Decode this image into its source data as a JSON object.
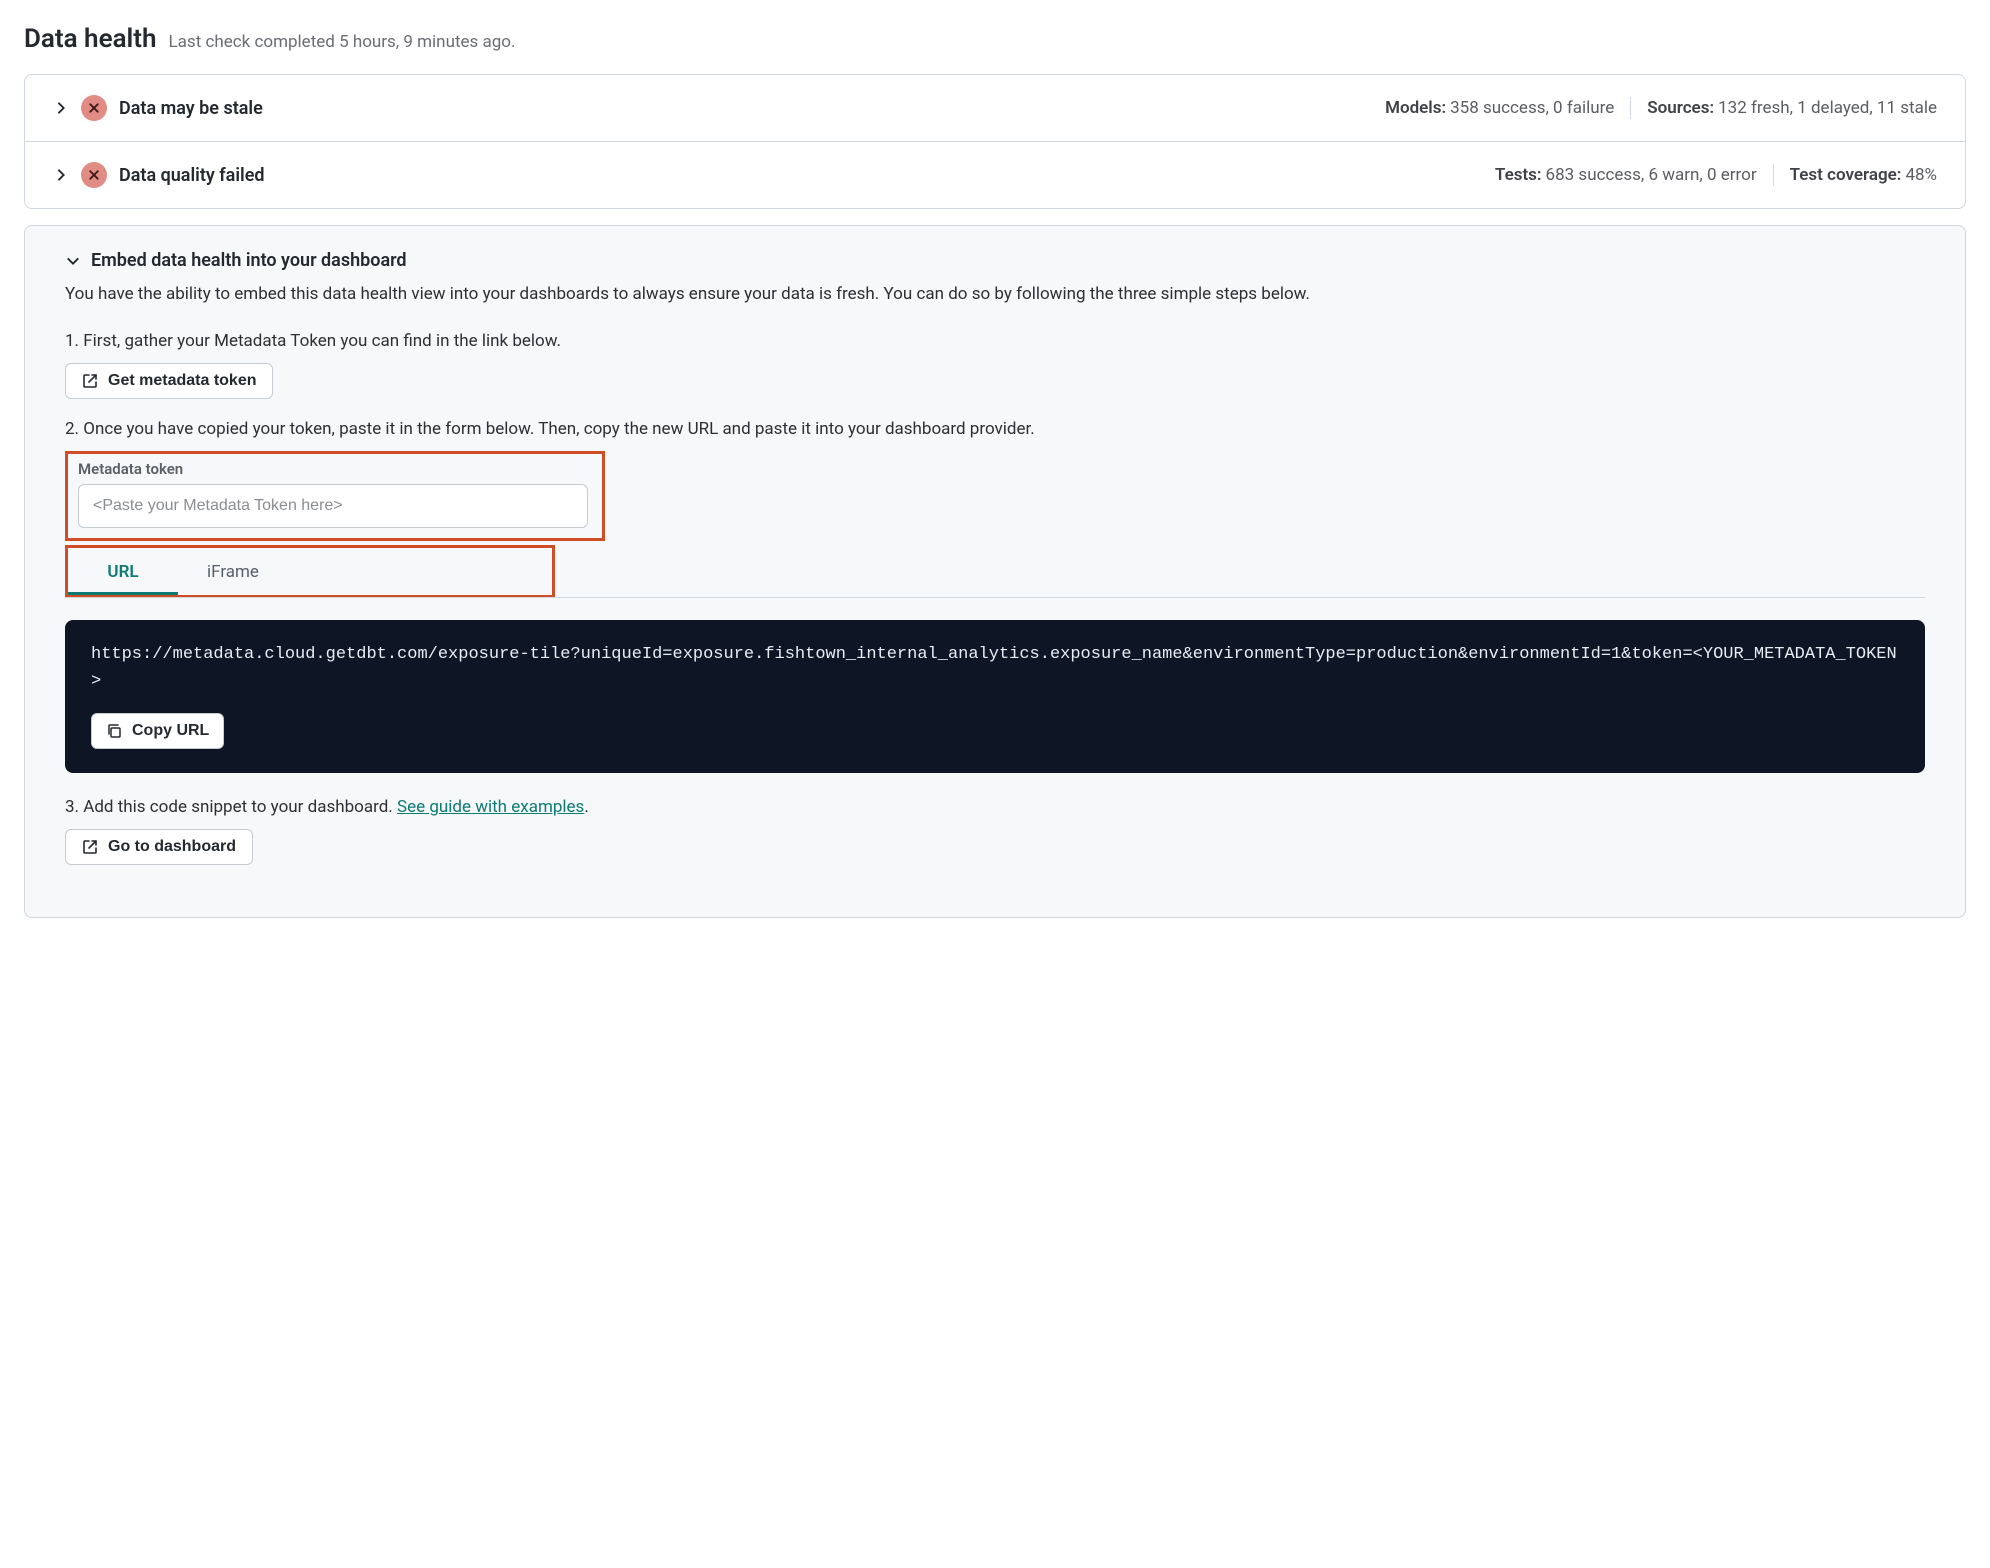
{
  "header": {
    "title": "Data health",
    "subtitle": "Last check completed 5 hours, 9 minutes ago."
  },
  "status_rows": [
    {
      "title": "Data may be stale",
      "stats": [
        {
          "label": "Models:",
          "value": "358 success, 0 failure"
        },
        {
          "label": "Sources:",
          "value": "132 fresh, 1 delayed, 11 stale"
        }
      ]
    },
    {
      "title": "Data quality failed",
      "stats": [
        {
          "label": "Tests:",
          "value": "683 success, 6 warn, 0 error"
        },
        {
          "label": "Test coverage:",
          "value": "48%"
        }
      ]
    }
  ],
  "embed": {
    "title": "Embed data health into your dashboard",
    "description": "You have the ability to embed this data health view into your dashboards to always ensure your data is fresh. You can do so by following the three simple steps below.",
    "step1_text": "1. First, gather your Metadata Token you can find in the link below.",
    "get_token_btn": "Get metadata token",
    "step2_text": "2. Once you have copied your token, paste it in the form below. Then, copy the new URL and paste it into your dashboard provider.",
    "token_label": "Metadata token",
    "token_placeholder": "<Paste your Metadata Token here>",
    "tabs": {
      "url": "URL",
      "iframe": "iFrame"
    },
    "code": "https://metadata.cloud.getdbt.com/exposure-tile?uniqueId=exposure.fishtown_internal_analytics.exposure_name&environmentType=production&environmentId=1&token=<YOUR_METADATA_TOKEN>",
    "copy_btn": "Copy URL",
    "step3_prefix": "3. Add this code snippet to your dashboard. ",
    "step3_link": "See guide with examples",
    "step3_suffix": ".",
    "go_dashboard_btn": "Go to dashboard"
  }
}
